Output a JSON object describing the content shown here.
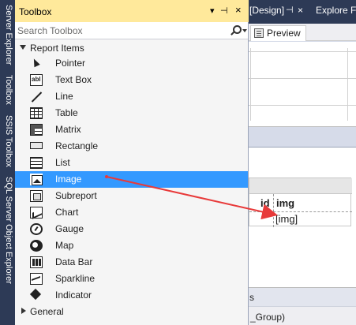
{
  "side_strip": {
    "tabs": [
      "Server Explorer",
      "Toolbox",
      "SSIS Toolbox",
      "SQL Server Object Explorer"
    ]
  },
  "document": {
    "tabs": [
      "[Design]",
      "Explore Fa"
    ],
    "pin_glyph": "⊣",
    "close_glyph": "×",
    "view_tab": "Preview",
    "table": {
      "header": [
        "id",
        "img"
      ],
      "row": [
        "",
        "[img]"
      ]
    },
    "bottom_panel": {
      "header_text": "s",
      "row_text": "_Group)"
    }
  },
  "toolbox": {
    "title": "Toolbox",
    "search_placeholder": "Search Toolbox",
    "groups": [
      {
        "label": "Report Items",
        "expanded": true,
        "items": [
          {
            "label": "Pointer",
            "icon": "pointer-icon"
          },
          {
            "label": "Text Box",
            "icon": "textbox-icon"
          },
          {
            "label": "Line",
            "icon": "line-icon"
          },
          {
            "label": "Table",
            "icon": "table-icon"
          },
          {
            "label": "Matrix",
            "icon": "matrix-icon"
          },
          {
            "label": "Rectangle",
            "icon": "rectangle-icon"
          },
          {
            "label": "List",
            "icon": "list-icon"
          },
          {
            "label": "Image",
            "icon": "image-icon",
            "selected": true
          },
          {
            "label": "Subreport",
            "icon": "subreport-icon"
          },
          {
            "label": "Chart",
            "icon": "chart-icon"
          },
          {
            "label": "Gauge",
            "icon": "gauge-icon"
          },
          {
            "label": "Map",
            "icon": "map-icon"
          },
          {
            "label": "Data Bar",
            "icon": "databar-icon"
          },
          {
            "label": "Sparkline",
            "icon": "sparkline-icon"
          },
          {
            "label": "Indicator",
            "icon": "indicator-icon"
          }
        ]
      },
      {
        "label": "General",
        "expanded": false,
        "items": []
      }
    ]
  },
  "colors": {
    "title_bar": "#ffe99b",
    "selection": "#3399ff",
    "drag_arrow": "#e83a3a",
    "chrome": "#2d3a56"
  }
}
